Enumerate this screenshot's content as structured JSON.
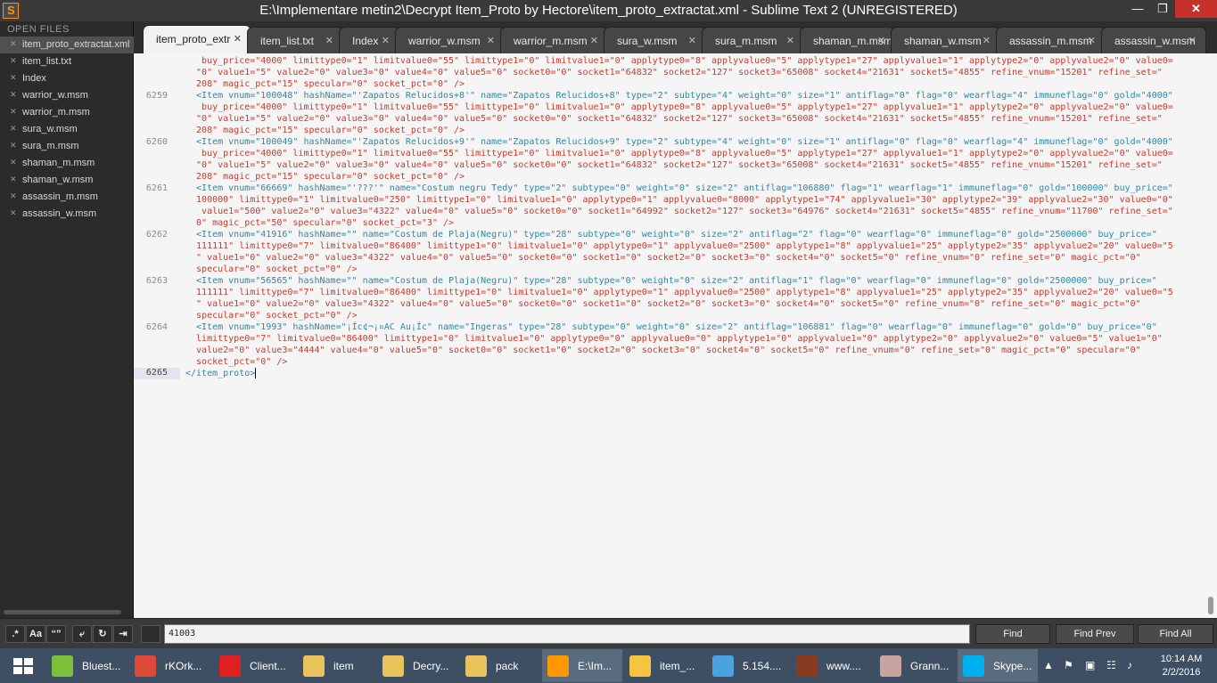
{
  "window": {
    "title": "E:\\Implementare metin2\\Decrypt Item_Proto  by Hectore\\item_proto_extractat.xml - Sublime Text 2 (UNREGISTERED)",
    "minimize": "—",
    "maximize": "❐",
    "close": "✕"
  },
  "sidebar": {
    "heading": "OPEN FILES",
    "files": [
      {
        "name": "item_proto_extractat.xml",
        "active": true
      },
      {
        "name": "item_list.txt"
      },
      {
        "name": "Index"
      },
      {
        "name": "warrior_w.msm"
      },
      {
        "name": "warrior_m.msm"
      },
      {
        "name": "sura_w.msm"
      },
      {
        "name": "sura_m.msm"
      },
      {
        "name": "shaman_m.msm"
      },
      {
        "name": "shaman_w.msm"
      },
      {
        "name": "assassin_m.msm"
      },
      {
        "name": "assassin_w.msm"
      }
    ]
  },
  "tabs": [
    {
      "label": "item_proto_extr",
      "active": true
    },
    {
      "label": "item_list.txt"
    },
    {
      "label": "Index"
    },
    {
      "label": "warrior_w.msm"
    },
    {
      "label": "warrior_m.msm"
    },
    {
      "label": "sura_w.msm"
    },
    {
      "label": "sura_m.msm"
    },
    {
      "label": "shaman_m.msm"
    },
    {
      "label": "shaman_w.msm"
    },
    {
      "label": "assassin_m.msm"
    },
    {
      "label": "assassin_w.msm"
    }
  ],
  "editor": {
    "lines": [
      {
        "num": "",
        "text": "   buy_price=\"4000\" limittype0=\"1\" limitvalue0=\"55\" limittype1=\"0\" limitvalue1=\"0\" applytype0=\"8\" applyvalue0=\"5\" applytype1=\"27\" applyvalue1=\"1\" applytype2=\"0\" applyvalue2=\"0\" value0="
      },
      {
        "num": "",
        "text": "  \"0\" value1=\"5\" value2=\"0\" value3=\"0\" value4=\"0\" value5=\"0\" socket0=\"0\" socket1=\"64832\" socket2=\"127\" socket3=\"65008\" socket4=\"21631\" socket5=\"4855\" refine_vnum=\"15201\" refine_set=\""
      },
      {
        "num": "",
        "text": "  208\" magic_pct=\"15\" specular=\"0\" socket_pct=\"0\" />"
      },
      {
        "num": "6259",
        "text": "  <Item vnum=\"100048\" hashName=\"'Zapatos Relucidos+8'\" name=\"Zapatos Relucidos+8\" type=\"2\" subtype=\"4\" weight=\"0\" size=\"1\" antiflag=\"0\" flag=\"0\" wearflag=\"4\" immuneflag=\"0\" gold=\"4000\""
      },
      {
        "num": "",
        "text": "   buy_price=\"4000\" limittype0=\"1\" limitvalue0=\"55\" limittype1=\"0\" limitvalue1=\"0\" applytype0=\"8\" applyvalue0=\"5\" applytype1=\"27\" applyvalue1=\"1\" applytype2=\"0\" applyvalue2=\"0\" value0="
      },
      {
        "num": "",
        "text": "  \"0\" value1=\"5\" value2=\"0\" value3=\"0\" value4=\"0\" value5=\"0\" socket0=\"0\" socket1=\"64832\" socket2=\"127\" socket3=\"65008\" socket4=\"21631\" socket5=\"4855\" refine_vnum=\"15201\" refine_set=\""
      },
      {
        "num": "",
        "text": "  208\" magic_pct=\"15\" specular=\"0\" socket_pct=\"0\" />"
      },
      {
        "num": "6260",
        "text": "  <Item vnum=\"100049\" hashName=\"'Zapatos Relucidos+9'\" name=\"Zapatos Relucidos+9\" type=\"2\" subtype=\"4\" weight=\"0\" size=\"1\" antiflag=\"0\" flag=\"0\" wearflag=\"4\" immuneflag=\"0\" gold=\"4000\""
      },
      {
        "num": "",
        "text": "   buy_price=\"4000\" limittype0=\"1\" limitvalue0=\"55\" limittype1=\"0\" limitvalue1=\"0\" applytype0=\"8\" applyvalue0=\"5\" applytype1=\"27\" applyvalue1=\"1\" applytype2=\"0\" applyvalue2=\"0\" value0="
      },
      {
        "num": "",
        "text": "  \"0\" value1=\"5\" value2=\"0\" value3=\"0\" value4=\"0\" value5=\"0\" socket0=\"0\" socket1=\"64832\" socket2=\"127\" socket3=\"65008\" socket4=\"21631\" socket5=\"4855\" refine_vnum=\"15201\" refine_set=\""
      },
      {
        "num": "",
        "text": "  208\" magic_pct=\"15\" specular=\"0\" socket_pct=\"0\" />"
      },
      {
        "num": "6261",
        "text": "  <Item vnum=\"66669\" hashName=\"'???'\" name=\"Costum negru Tedy\" type=\"2\" subtype=\"0\" weight=\"0\" size=\"2\" antiflag=\"106880\" flag=\"1\" wearflag=\"1\" immuneflag=\"0\" gold=\"100000\" buy_price=\""
      },
      {
        "num": "",
        "text": "  100000\" limittype0=\"1\" limitvalue0=\"250\" limittype1=\"0\" limitvalue1=\"0\" applytype0=\"1\" applyvalue0=\"8000\" applytype1=\"74\" applyvalue1=\"30\" applytype2=\"39\" applyvalue2=\"30\" value0=\"0\""
      },
      {
        "num": "",
        "text": "   value1=\"500\" value2=\"0\" value3=\"4322\" value4=\"0\" value5=\"0\" socket0=\"0\" socket1=\"64992\" socket2=\"127\" socket3=\"64976\" socket4=\"21631\" socket5=\"4855\" refine_vnum=\"11700\" refine_set=\""
      },
      {
        "num": "",
        "text": "  0\" magic_pct=\"50\" specular=\"0\" socket_pct=\"3\" />"
      },
      {
        "num": "6262",
        "text": "  <Item vnum=\"41916\" hashName=\"\" name=\"Costum de Plaja(Negru)\" type=\"28\" subtype=\"0\" weight=\"0\" size=\"2\" antiflag=\"2\" flag=\"0\" wearflag=\"0\" immuneflag=\"0\" gold=\"2500000\" buy_price=\""
      },
      {
        "num": "",
        "text": "  111111\" limittype0=\"7\" limitvalue0=\"86400\" limittype1=\"0\" limitvalue1=\"0\" applytype0=\"1\" applyvalue0=\"2500\" applytype1=\"8\" applyvalue1=\"25\" applytype2=\"35\" applyvalue2=\"20\" value0=\"5"
      },
      {
        "num": "",
        "text": "  \" value1=\"0\" value2=\"0\" value3=\"4322\" value4=\"0\" value5=\"0\" socket0=\"0\" socket1=\"0\" socket2=\"0\" socket3=\"0\" socket4=\"0\" socket5=\"0\" refine_vnum=\"0\" refine_set=\"0\" magic_pct=\"0\""
      },
      {
        "num": "",
        "text": "  specular=\"0\" socket_pct=\"0\" />"
      },
      {
        "num": "6263",
        "text": "  <Item vnum=\"56565\" hashName=\"\" name=\"Costum de Plaja(Negru)\" type=\"28\" subtype=\"0\" weight=\"0\" size=\"2\" antiflag=\"1\" flag=\"0\" wearflag=\"0\" immuneflag=\"0\" gold=\"2500000\" buy_price=\""
      },
      {
        "num": "",
        "text": "  111111\" limittype0=\"7\" limitvalue0=\"86400\" limittype1=\"0\" limitvalue1=\"0\" applytype0=\"1\" applyvalue0=\"2500\" applytype1=\"8\" applyvalue1=\"25\" applytype2=\"35\" applyvalue2=\"20\" value0=\"5"
      },
      {
        "num": "",
        "text": "  \" value1=\"0\" value2=\"0\" value3=\"4322\" value4=\"0\" value5=\"0\" socket0=\"0\" socket1=\"0\" socket2=\"0\" socket3=\"0\" socket4=\"0\" socket5=\"0\" refine_vnum=\"0\" refine_set=\"0\" magic_pct=\"0\""
      },
      {
        "num": "",
        "text": "  specular=\"0\" socket_pct=\"0\" />"
      },
      {
        "num": "6264",
        "text": "  <Item vnum=\"1993\" hashName=\"¡Íc¢¬¡¤AC Au¡Íc\" name=\"Ingeras\" type=\"28\" subtype=\"0\" weight=\"0\" size=\"2\" antiflag=\"106881\" flag=\"0\" wearflag=\"0\" immuneflag=\"0\" gold=\"0\" buy_price=\"0\""
      },
      {
        "num": "",
        "text": "  limittype0=\"7\" limitvalue0=\"86400\" limittype1=\"0\" limitvalue1=\"0\" applytype0=\"0\" applyvalue0=\"0\" applytype1=\"0\" applyvalue1=\"0\" applytype2=\"0\" applyvalue2=\"0\" value0=\"5\" value1=\"0\""
      },
      {
        "num": "",
        "text": "  value2=\"0\" value3=\"4444\" value4=\"0\" value5=\"0\" socket0=\"0\" socket1=\"0\" socket2=\"0\" socket3=\"0\" socket4=\"0\" socket5=\"0\" refine_vnum=\"0\" refine_set=\"0\" magic_pct=\"0\" specular=\"0\""
      },
      {
        "num": "",
        "text": "  socket_pct=\"0\" />"
      }
    ],
    "last_line": {
      "num": "6265",
      "text": "</item_proto>"
    }
  },
  "find": {
    "regex_label": ".*",
    "case_label": "Aa",
    "word_label": "“”",
    "wrap_label": "⤶",
    "in_selection_label": "↻",
    "highlight_label": "⇥",
    "query": "41003",
    "find_label": "Find",
    "find_prev_label": "Find Prev",
    "find_all_label": "Find All"
  },
  "taskbar": {
    "items": [
      {
        "label": "Bluest...",
        "color": "#7cbf3b"
      },
      {
        "label": "rKOrk...",
        "color": "#de4a3a"
      },
      {
        "label": "Client...",
        "color": "#e02020"
      },
      {
        "label": "item",
        "color": "#e8c25a"
      },
      {
        "label": "Decry...",
        "color": "#e8c25a"
      },
      {
        "label": "pack",
        "color": "#e8c25a"
      },
      {
        "label": "E:\\Im...",
        "color": "#ff9800",
        "active": true
      },
      {
        "label": "item_...",
        "color": "#f5c542"
      },
      {
        "label": "5.154....",
        "color": "#4aa3df"
      },
      {
        "label": "www....",
        "color": "#8a3a20"
      },
      {
        "label": "Grann...",
        "color": "#c9a3a0"
      },
      {
        "label": "Skype...",
        "color": "#00aff0",
        "active": true
      }
    ],
    "tray_icons": [
      "▲",
      "⚑",
      "▣",
      "☷",
      "♪"
    ],
    "time": "10:14 AM",
    "date": "2/2/2016"
  }
}
